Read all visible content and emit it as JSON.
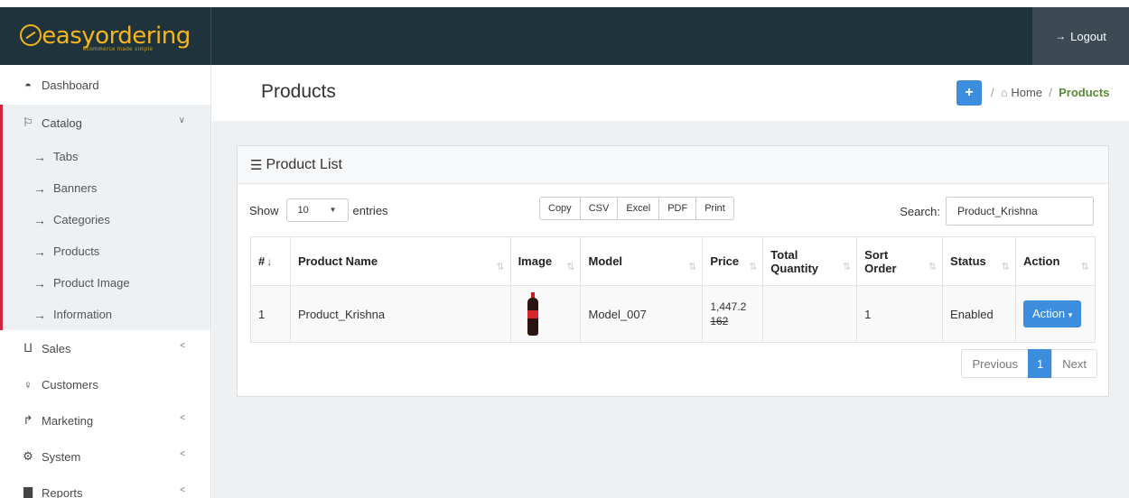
{
  "brand": {
    "logo_text": "easyordering",
    "logo_tagline": "ecommerce made simple"
  },
  "header": {
    "logout_label": "Logout",
    "logout_icon": "sign-out-icon"
  },
  "sidebar": {
    "accent_color": "#d2233f",
    "items": [
      {
        "label": "Dashboard",
        "icon": "dashboard-icon"
      },
      {
        "label": "Catalog",
        "icon": "tag-icon",
        "expanded": true
      },
      {
        "label": "Sales",
        "icon": "cart-icon"
      },
      {
        "label": "Customers",
        "icon": "user-icon"
      },
      {
        "label": "Marketing",
        "icon": "share-icon"
      },
      {
        "label": "System",
        "icon": "gear-icon"
      },
      {
        "label": "Reports",
        "icon": "bar-chart-icon"
      }
    ],
    "catalog_children": [
      "Tabs",
      "Banners",
      "Categories",
      "Products",
      "Product Image",
      "Information"
    ]
  },
  "page": {
    "title": "Products",
    "add_button_label": "+",
    "breadcrumb": {
      "home": "Home",
      "current": "Products"
    }
  },
  "panel": {
    "title": "Product List",
    "show_label": "Show",
    "entries_value": "10",
    "entries_label": "entries",
    "export_buttons": [
      "Copy",
      "CSV",
      "Excel",
      "PDF",
      "Print"
    ],
    "search_label": "Search:",
    "search_value": "Product_Krishna"
  },
  "table": {
    "columns": [
      "#",
      "Product Name",
      "Image",
      "Model",
      "Price",
      "Total Quantity",
      "Sort Order",
      "Status",
      "Action"
    ],
    "rows": [
      {
        "index": "1",
        "name": "Product_Krishna",
        "image": "cola-bottle-image",
        "model": "Model_007",
        "price": "1,447.2",
        "old_price": "162",
        "total_quantity": "",
        "sort_order": "1",
        "status": "Enabled",
        "action_label": "Action"
      }
    ]
  },
  "pagination": {
    "previous": "Previous",
    "current": "1",
    "next": "Next"
  },
  "colors": {
    "topbar": "#1f333d",
    "logo": "#f5b51b",
    "primary": "#3c8dde",
    "breadcrumb_active": "#5a8a3a"
  }
}
